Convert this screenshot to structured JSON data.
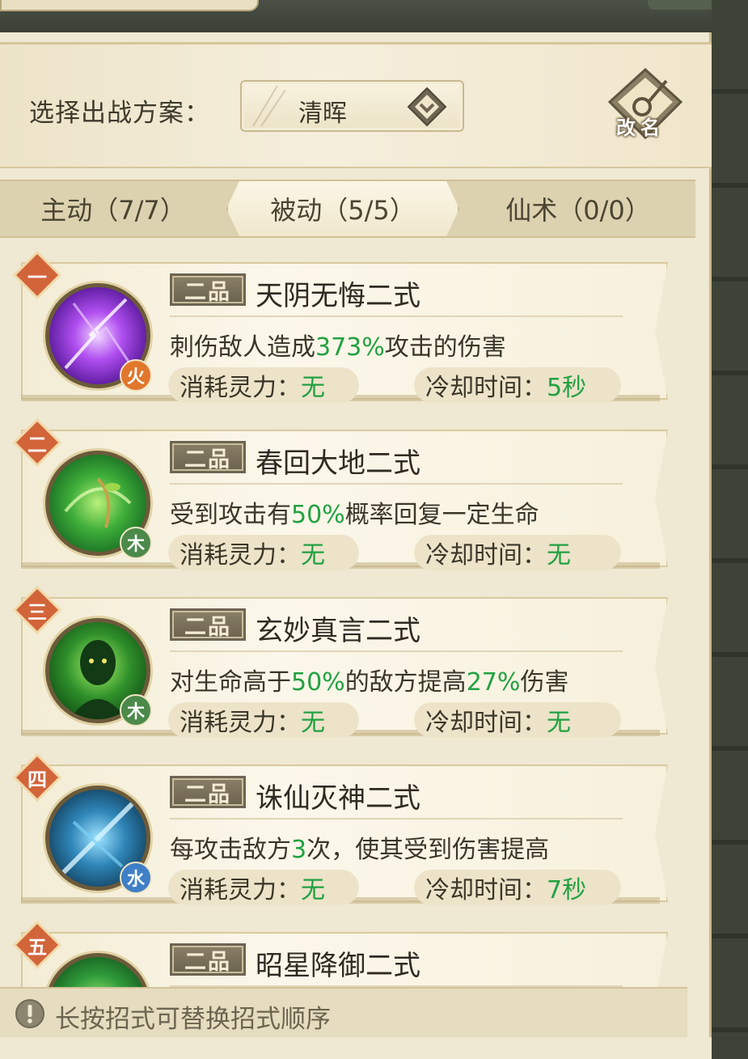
{
  "header": {
    "plan_label": "选择出战方案：",
    "plan_value": "清晖",
    "rename_label": "改名"
  },
  "tabs": [
    {
      "label": "主动（7/7）",
      "active": false
    },
    {
      "label": "被动（5/5）",
      "active": true
    },
    {
      "label": "仙术（0/0）",
      "active": false
    }
  ],
  "skills": [
    {
      "rank": "一",
      "grade": "二品",
      "name": "天阴无悔二式",
      "element": "火",
      "element_color": "#e0772c",
      "desc_pre": "刺伤敌人造成",
      "desc_hl": "373%",
      "desc_post": "攻击的伤害",
      "desc_hl2": "",
      "desc_post2": "",
      "cost_label": "消耗灵力：",
      "cost_value": "无",
      "cd_label": "冷却时间：",
      "cd_value": "5秒"
    },
    {
      "rank": "二",
      "grade": "二品",
      "name": "春回大地二式",
      "element": "木",
      "element_color": "#4b8a4a",
      "desc_pre": "受到攻击有",
      "desc_hl": "50%",
      "desc_post": "概率回复一定生命",
      "desc_hl2": "",
      "desc_post2": "",
      "cost_label": "消耗灵力：",
      "cost_value": "无",
      "cd_label": "冷却时间：",
      "cd_value": "无"
    },
    {
      "rank": "三",
      "grade": "二品",
      "name": "玄妙真言二式",
      "element": "木",
      "element_color": "#4b8a4a",
      "desc_pre": "对生命高于",
      "desc_hl": "50%",
      "desc_post": "的敌方提高",
      "desc_hl2": "27%",
      "desc_post2": "伤害",
      "cost_label": "消耗灵力：",
      "cost_value": "无",
      "cd_label": "冷却时间：",
      "cd_value": "无"
    },
    {
      "rank": "四",
      "grade": "二品",
      "name": "诛仙灭神二式",
      "element": "水",
      "element_color": "#3f7fc7",
      "desc_pre": "每攻击敌方",
      "desc_hl": "3",
      "desc_post": "次，使其受到伤害提高",
      "desc_hl2": "",
      "desc_post2": "",
      "cost_label": "消耗灵力：",
      "cost_value": "无",
      "cd_label": "冷却时间：",
      "cd_value": "7秒"
    },
    {
      "rank": "五",
      "grade": "二品",
      "name": "昭星降御二式"
    }
  ],
  "tip": "长按招式可替换招式顺序",
  "colors": {
    "highlight_green": "#22a142",
    "rank_badge": "#d2643a",
    "parchment": "#efe8d2"
  }
}
